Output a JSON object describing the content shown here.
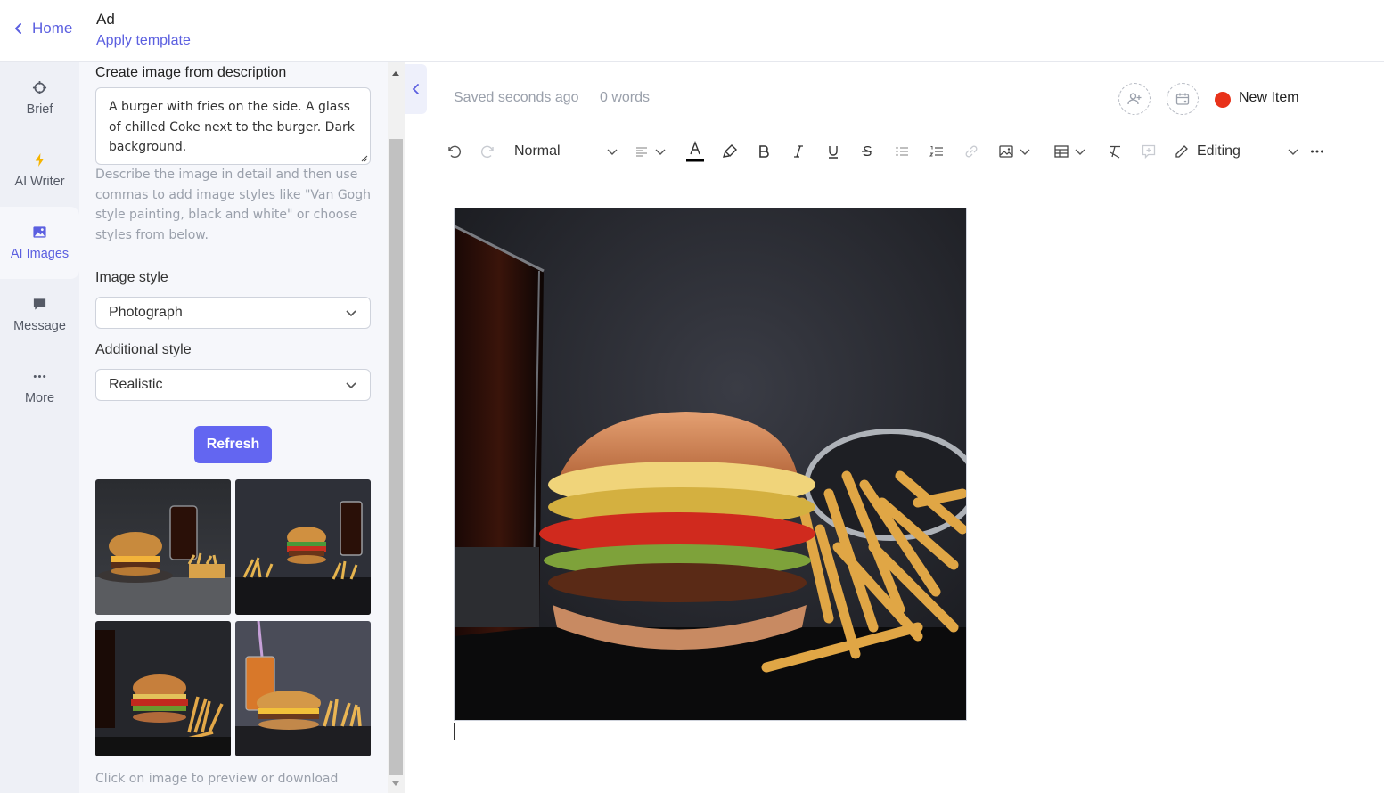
{
  "header": {
    "home_label": "Home",
    "doc_title": "Ad",
    "apply_template_label": "Apply template"
  },
  "nav": {
    "items": [
      {
        "label": "Brief",
        "icon": "crosshair-icon"
      },
      {
        "label": "AI Writer",
        "icon": "lightning-icon"
      },
      {
        "label": "AI Images",
        "icon": "image-icon"
      },
      {
        "label": "Message",
        "icon": "message-icon"
      },
      {
        "label": "More",
        "icon": "more-icon"
      }
    ],
    "active": "AI Images"
  },
  "panel": {
    "heading": "Create image from description",
    "description_value": "A burger with fries on the side. A glass of chilled Coke next to the burger. Dark background.",
    "help_text": "Describe the image in detail and then use commas to add image styles like \"Van Gogh style painting, black and white\" or choose styles from below.",
    "image_style_label": "Image style",
    "image_style_value": "Photograph",
    "additional_style_label": "Additional style",
    "additional_style_value": "Realistic",
    "refresh_label": "Refresh",
    "hint": "Click on image to preview or download"
  },
  "editor": {
    "saved_status": "Saved seconds ago",
    "word_count": "0 words",
    "status_label": "New Item",
    "status_color": "#e8321a",
    "paragraph_style": "Normal",
    "mode_label": "Editing"
  },
  "colors": {
    "accent": "#6366f1",
    "nav_bg": "#eef0f6",
    "panel_bg": "#f6f7fb"
  }
}
